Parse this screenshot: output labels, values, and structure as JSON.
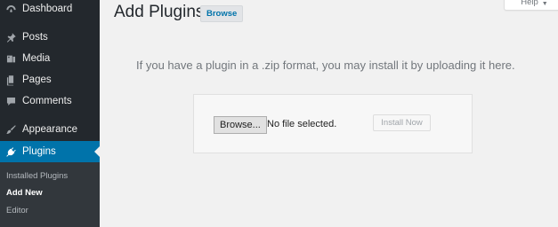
{
  "sidebar": {
    "items": [
      {
        "label": "Dashboard",
        "icon": "dashboard-icon"
      },
      {
        "label": "Posts",
        "icon": "pushpin-icon"
      },
      {
        "label": "Media",
        "icon": "media-icon"
      },
      {
        "label": "Pages",
        "icon": "pages-icon"
      },
      {
        "label": "Comments",
        "icon": "comment-icon"
      },
      {
        "label": "Appearance",
        "icon": "paintbrush-icon"
      },
      {
        "label": "Plugins",
        "icon": "plugin-icon"
      }
    ],
    "submenu": [
      "Installed Plugins",
      "Add New",
      "Editor"
    ],
    "accent_color": "#0073aa",
    "background_color": "#23282d"
  },
  "header": {
    "title": "Add Plugins",
    "browse_label": "Browse",
    "help_label": "Help"
  },
  "upload": {
    "message": "If you have a plugin in a .zip format, you may install it by uploading it here.",
    "file_button_label": "Browse...",
    "file_status": "No file selected.",
    "install_label": "Install Now"
  }
}
